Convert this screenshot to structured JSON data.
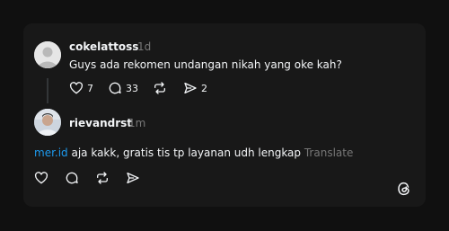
{
  "comment1": {
    "username": "cokelattoss",
    "time": "1d",
    "text": "Guys ada rekomen undangan nikah yang oke kah?",
    "likes": "7",
    "replies": "33",
    "shares": "2"
  },
  "comment2": {
    "username": "rievandrst",
    "time": "1m",
    "mention": "mer.id",
    "text": " aja kakk, gratis tis tp layanan udh lengkap",
    "translate": "Translate"
  },
  "icons": {
    "like": "heart-icon",
    "reply": "comment-icon",
    "repost": "repost-icon",
    "share": "send-icon",
    "logo": "threads-logo-icon"
  }
}
